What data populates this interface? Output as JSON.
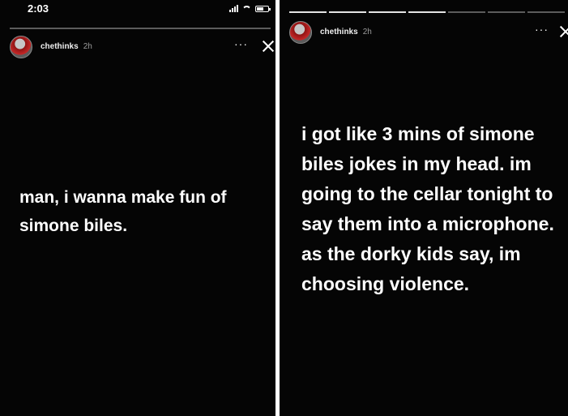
{
  "status_bar": {
    "time": "2:03"
  },
  "stories": [
    {
      "progress": {
        "total": 1,
        "seen": 0
      },
      "username": "chethinks",
      "posted": "2h",
      "more_label": "···",
      "text": "man, i wanna make fun of simone biles."
    },
    {
      "progress": {
        "total": 7,
        "seen": 4
      },
      "username": "chethinks",
      "posted": "2h",
      "more_label": "···",
      "text": "i got like 3 mins of simone biles jokes in my head. im going to the cellar tonight to say them into a microphone. as the dorky kids say, im choosing violence."
    }
  ],
  "icons": {
    "signal": "signal-icon",
    "wifi": "wifi-icon",
    "battery": "battery-icon",
    "close": "close-icon",
    "more": "more-icon",
    "avatar": "avatar"
  },
  "colors": {
    "background": "#050505",
    "text": "#ffffff",
    "muted": "#9a9a9a",
    "progress_seen": "#e4e4e4",
    "progress_unseen": "#5c5c5c"
  }
}
